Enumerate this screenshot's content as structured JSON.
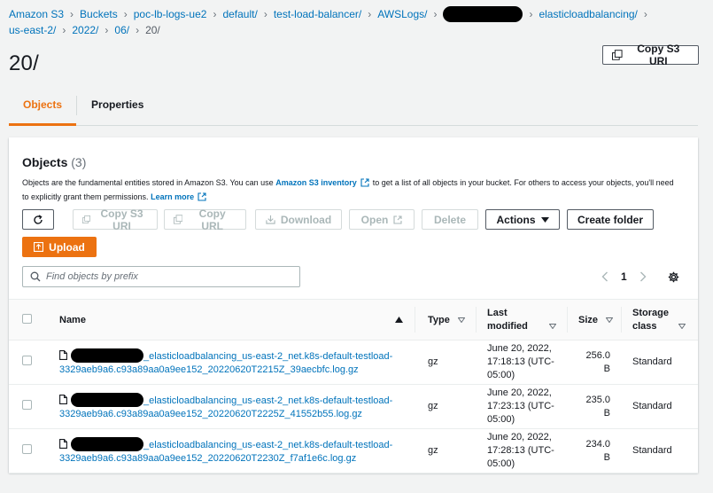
{
  "breadcrumbs": [
    {
      "label": "Amazon S3",
      "type": "link"
    },
    {
      "label": "Buckets",
      "type": "link"
    },
    {
      "label": "poc-lb-logs-ue2",
      "type": "link"
    },
    {
      "label": "default/",
      "type": "link"
    },
    {
      "label": "test-load-balancer/",
      "type": "link"
    },
    {
      "label": "AWSLogs/",
      "type": "link"
    },
    {
      "label": "",
      "type": "redacted"
    },
    {
      "label": "elasticloadbalancing/",
      "type": "link"
    },
    {
      "label": "us-east-2/",
      "type": "link"
    },
    {
      "label": "2022/",
      "type": "link"
    },
    {
      "label": "06/",
      "type": "link"
    },
    {
      "label": "20/",
      "type": "current"
    }
  ],
  "page": {
    "title": "20/",
    "copy_uri_label": "Copy S3 URI"
  },
  "tabs": [
    {
      "label": "Objects",
      "active": true
    },
    {
      "label": "Properties",
      "active": false
    }
  ],
  "objects_panel": {
    "title": "Objects",
    "count": "(3)",
    "desc_1": "Objects are the fundamental entities stored in Amazon S3. You can use",
    "inventory_link": "Amazon S3 inventory",
    "desc_2": "to get a list of all objects in your bucket. For others to access your objects, you'll need to explicitly grant them permissions.",
    "learn_more": "Learn more"
  },
  "toolbar": {
    "copy_s3_uri": "Copy S3 URI",
    "copy_url": "Copy URL",
    "download": "Download",
    "open": "Open",
    "delete": "Delete",
    "actions": "Actions",
    "create_folder": "Create folder",
    "upload": "Upload"
  },
  "search": {
    "placeholder": "Find objects by prefix"
  },
  "pagination": {
    "current_page": "1"
  },
  "table": {
    "headers": {
      "name": "Name",
      "type": "Type",
      "last_modified": "Last modified",
      "size": "Size",
      "storage_class": "Storage class"
    },
    "rows": [
      {
        "name_suffix": "_elasticloadbalancing_us-east-2_net.k8s-default-testload-3329aeb9a6.c93a89aa0a9ee152_20220620T2215Z_39aecbfc.log.gz",
        "type": "gz",
        "last_modified": "June 20, 2022, 17:18:13 (UTC-05:00)",
        "size": "256.0 B",
        "storage_class": "Standard"
      },
      {
        "name_suffix": "_elasticloadbalancing_us-east-2_net.k8s-default-testload-3329aeb9a6.c93a89aa0a9ee152_20220620T2225Z_41552b55.log.gz",
        "type": "gz",
        "last_modified": "June 20, 2022, 17:23:13 (UTC-05:00)",
        "size": "235.0 B",
        "storage_class": "Standard"
      },
      {
        "name_suffix": "_elasticloadbalancing_us-east-2_net.k8s-default-testload-3329aeb9a6.c93a89aa0a9ee152_20220620T2230Z_f7af1e6c.log.gz",
        "type": "gz",
        "last_modified": "June 20, 2022, 17:28:13 (UTC-05:00)",
        "size": "234.0 B",
        "storage_class": "Standard"
      }
    ]
  },
  "icons": {
    "refresh": "refresh-icon",
    "copy": "copy-icon",
    "download": "download-icon",
    "external": "external-link-icon",
    "upload": "upload-icon",
    "search": "search-icon",
    "settings": "gear-icon",
    "file": "file-icon",
    "sort": "sort-icon"
  },
  "colors": {
    "link": "#0073bb",
    "accent": "#ec7211",
    "text": "#16191f",
    "muted": "#687078",
    "background": "#f2f3f3"
  }
}
